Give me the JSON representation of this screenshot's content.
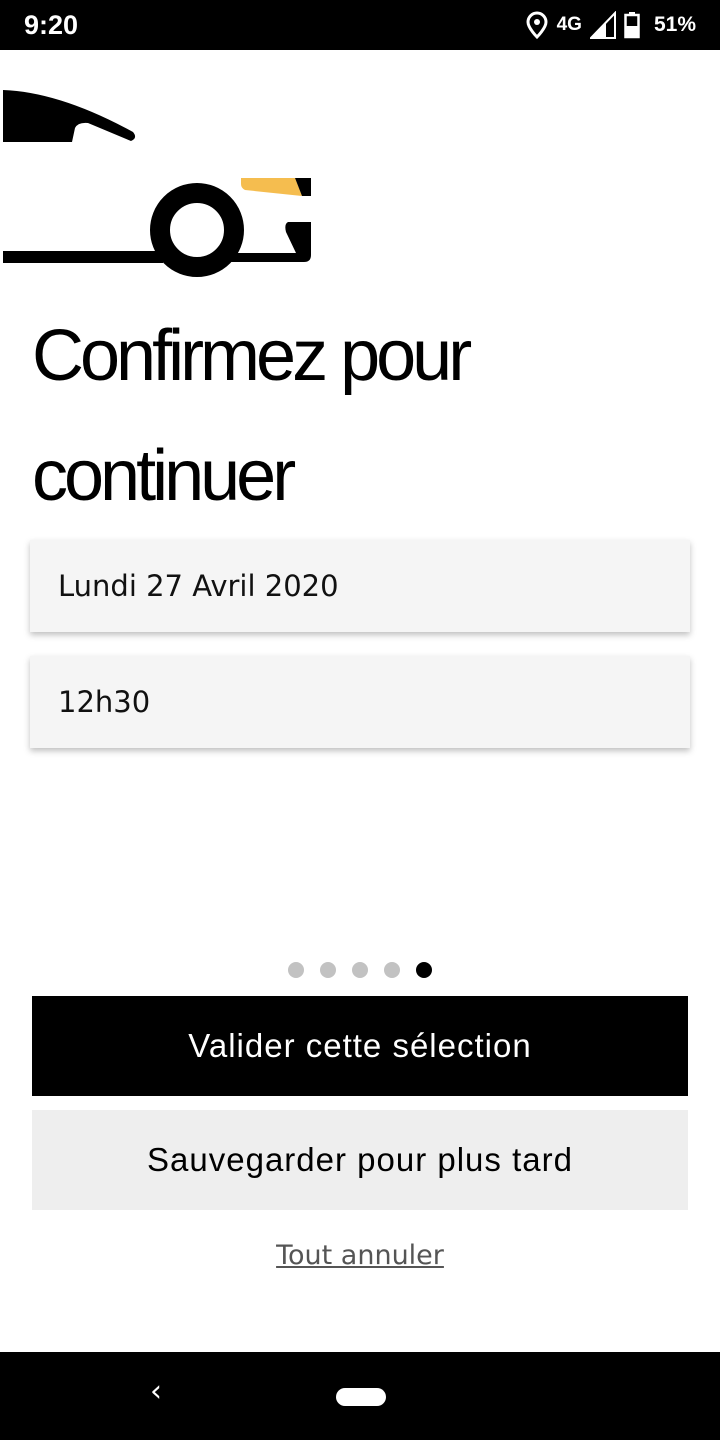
{
  "status_bar": {
    "time": "9:20",
    "network": "4G",
    "battery": "51%",
    "icons": [
      "location-icon",
      "signal-icon",
      "battery-icon"
    ]
  },
  "illustration": {
    "name": "car-illustration",
    "accent_color": "#f5bd4f"
  },
  "title": "Confirmez pour continuer",
  "fields": {
    "date": "Lundi 27 Avril 2020",
    "time": "12h30"
  },
  "pager": {
    "total": 5,
    "current": 5
  },
  "buttons": {
    "confirm": "Valider cette sélection",
    "save": "Sauvegarder pour plus tard",
    "cancel": "Tout annuler"
  },
  "nav_bar": {
    "icons": [
      "back-icon",
      "home-icon"
    ]
  }
}
